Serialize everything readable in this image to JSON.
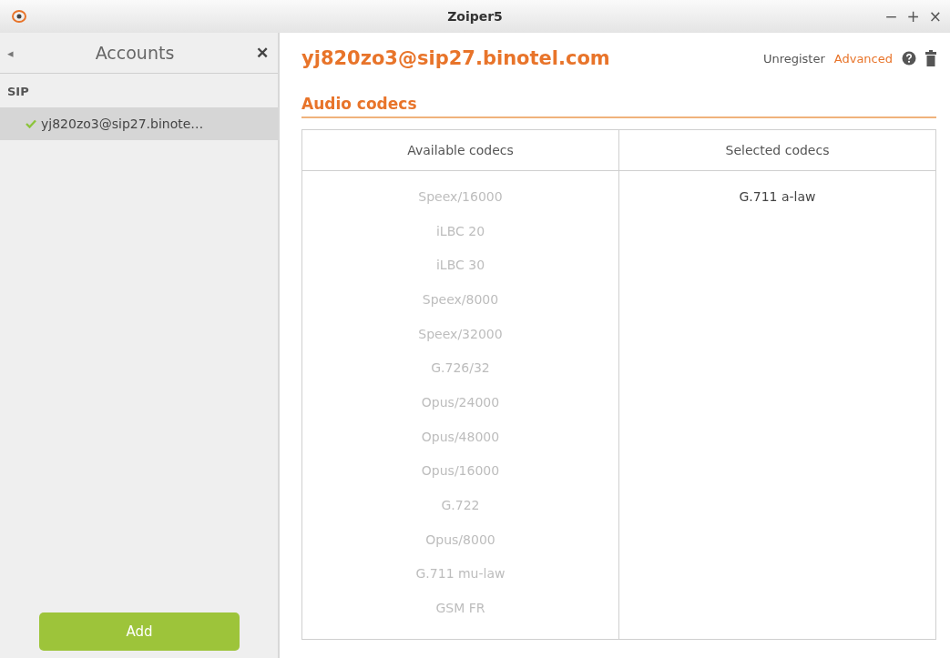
{
  "window": {
    "title": "Zoiper5",
    "controls": [
      "−",
      "+",
      "×"
    ]
  },
  "sidebar": {
    "title": "Accounts",
    "back": "◂",
    "close": "✕",
    "group": "SIP",
    "items": [
      {
        "label": "yj820zo3@sip27.binote…",
        "selected": true,
        "registered": true
      }
    ],
    "add_button": "Add"
  },
  "account": {
    "title": "yj820zo3@sip27.binotel.com",
    "actions": [
      {
        "label": "Unregister",
        "selected": false
      },
      {
        "label": "Advanced",
        "selected": true
      }
    ]
  },
  "section": {
    "title": "Audio codecs"
  },
  "table": {
    "columns": [
      "Available codecs",
      "Selected codecs"
    ],
    "available": [
      "Speex/16000",
      "iLBC 20",
      "iLBC 30",
      "Speex/8000",
      "Speex/32000",
      "G.726/32",
      "Opus/24000",
      "Opus/48000",
      "Opus/16000",
      "G.722",
      "Opus/8000",
      "G.711 mu-law",
      "GSM FR"
    ],
    "selected": [
      "G.711 a-law"
    ]
  }
}
